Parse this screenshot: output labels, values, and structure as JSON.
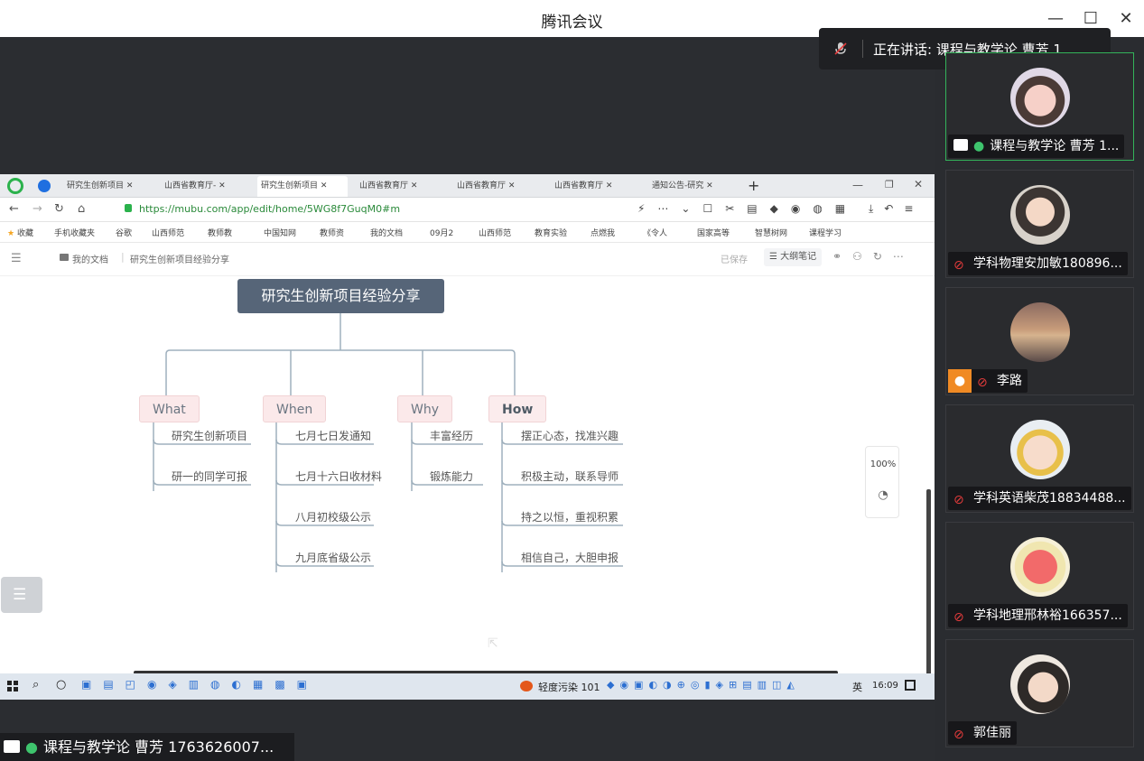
{
  "window": {
    "title": "腾讯会议"
  },
  "speaking_bar": {
    "text": "正在讲话: 课程与教学论 曹芳 1..."
  },
  "bottom_tag": {
    "name": "课程与教学论 曹芳 1763626007..."
  },
  "participants": [
    {
      "name": "课程与教学论 曹芳 1...",
      "active": true
    },
    {
      "name": "学科物理安加敏180896..."
    },
    {
      "name": "李路"
    },
    {
      "name": "学科英语柴茂18834488..."
    },
    {
      "name": "学科地理邢林裕166357..."
    },
    {
      "name": "郭佳丽"
    }
  ],
  "browser": {
    "tabs": [
      "研究生创新项目",
      "山西省教育厅-",
      "研究生创新项目",
      "山西省教育厅",
      "山西省教育厅",
      "山西省教育厅",
      "通知公告-研究"
    ],
    "url": "https://mubu.com/app/edit/home/5WG8f7GuqM0#m",
    "bookmarks": [
      "收藏",
      "手机收藏夹",
      "谷歌",
      "山西师范",
      "教师教",
      "中国知网",
      "教师资",
      "我的文档",
      "09月2",
      "山西师范",
      "教育实验",
      "点燃我",
      "《令人",
      "国家高等",
      "智慧树网",
      "课程学习"
    ]
  },
  "app": {
    "breadcrumb_root": "我的文档",
    "breadcrumb_doc": "研究生创新项目经验分享",
    "saved": "已保存",
    "outline_btn": "大纲笔记",
    "zoom": "100%"
  },
  "mindmap": {
    "root": "研究生创新项目经验分享",
    "branches": [
      {
        "label": "What",
        "items": [
          "研究生创新项目",
          "研一的同学可报"
        ]
      },
      {
        "label": "When",
        "items": [
          "七月七日发通知",
          "七月十六日收材料",
          "八月初校级公示",
          "九月底省级公示"
        ]
      },
      {
        "label": "Why",
        "items": [
          "丰富经历",
          "锻炼能力"
        ]
      },
      {
        "label": "How",
        "items": [
          "摆正心态，找准兴趣",
          "积极主动，联系导师",
          "持之以恒，重视积累",
          "相信自己，大胆申报"
        ]
      }
    ]
  },
  "taskbar": {
    "weather": "轻度污染 101",
    "ime": "英",
    "time": "16:09"
  }
}
